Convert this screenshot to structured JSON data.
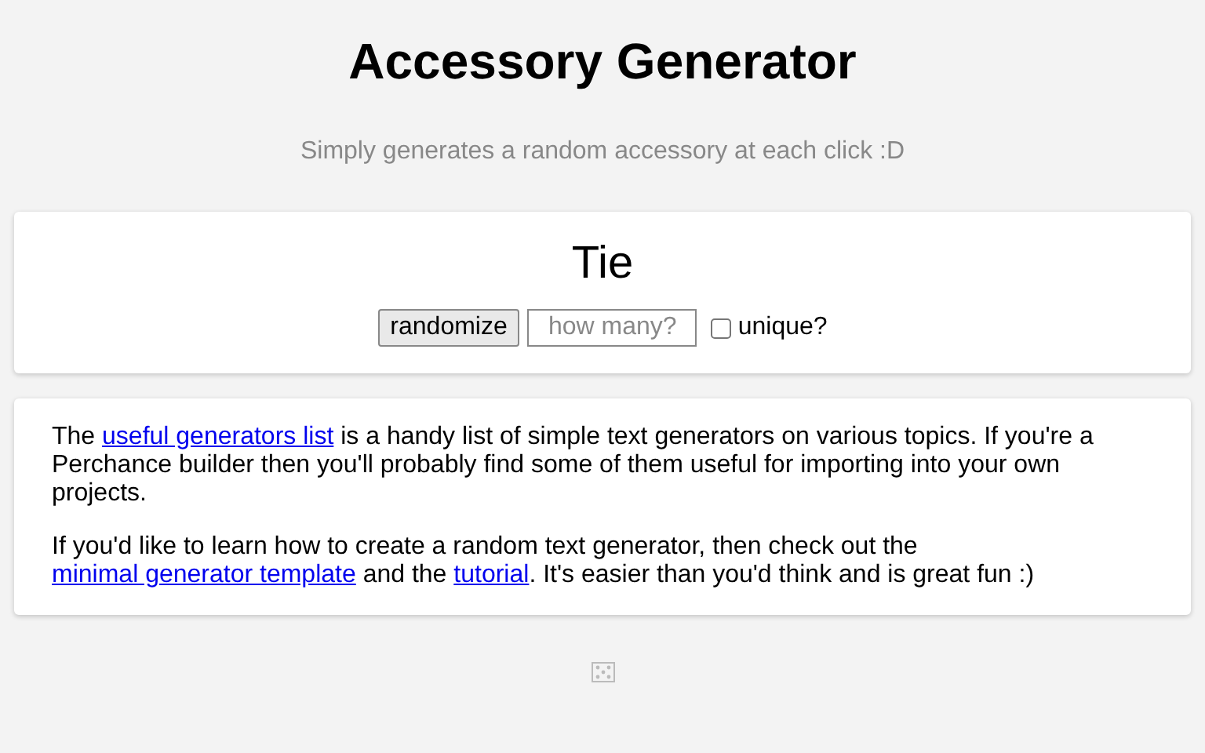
{
  "title": "Accessory Generator",
  "subtitle": "Simply generates a random accessory at each click :D",
  "result": "Tie",
  "controls": {
    "button": "randomize",
    "count_placeholder": "how many?",
    "unique_label": "unique?",
    "unique_checked": false
  },
  "info": [
    [
      {
        "kind": "text",
        "text": "The "
      },
      {
        "kind": "link",
        "text": "useful generators list"
      },
      {
        "kind": "text",
        "text": " is a handy list of simple text generators on various topics. If you're a Perchance builder then you'll probably find some of them useful for importing into your own projects."
      }
    ],
    [
      {
        "kind": "text",
        "text": "If you'd like to learn how to create a random text generator, then check out the "
      },
      {
        "kind": "link",
        "text": "minimal generator template"
      },
      {
        "kind": "text",
        "text": " and the "
      },
      {
        "kind": "link",
        "text": "tutorial"
      },
      {
        "kind": "text",
        "text": ". It's easier than you'd think and is great fun :)"
      }
    ]
  ]
}
